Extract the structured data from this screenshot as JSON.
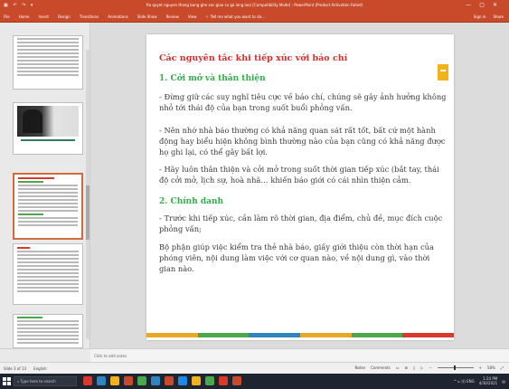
{
  "window": {
    "title": "Ra quyet nguyen thong bang ghe xac giao su ga lang lao) [Compatibility Mode] - PowerPoint (Product Activation Failed)",
    "qat_glyphs": "▣ ↶ ↷ ▾",
    "controls": [
      "—",
      "▢",
      "✕"
    ]
  },
  "menu": {
    "tabs": [
      "File",
      "Home",
      "Insert",
      "Design",
      "Transitions",
      "Animations",
      "Slide Show",
      "Review",
      "View"
    ],
    "tell_me": "Tell me what you want to do...",
    "right": [
      "Sign in",
      "Share"
    ]
  },
  "thumbnails": {
    "numbers": [
      "",
      "",
      "",
      "",
      ""
    ],
    "selected_index": 3
  },
  "slide": {
    "title": "Các nguyên tắc khi tiếp xúc với báo chí",
    "section1": "1. Cởi mở và thân thiện",
    "p1": "- Đừng giữ các suy nghĩ tiêu cực về báo chí, chúng sẽ gây ảnh hưởng không nhỏ tới thái độ của bạn trong suốt buổi phỏng vấn.",
    "p2": "- Nên nhớ nhà báo thường có khả năng quan sát rất tốt, bất cứ một hành động hay biểu hiện không bình thường nào của bạn cũng có khả năng được họ ghi lại, có thể gây bất lợi.",
    "p3": "- Hãy luôn thân thiện và cởi mở trong suốt thời gian tiếp xúc (bắt tay, thái độ cởi mở, lịch sự, hoà nhã… khiến báo giới có cái nhìn thiện cảm.",
    "section2": "2. Chính danh",
    "p4": " - Trước khi tiếp xúc, cần làm rõ thời gian, địa điểm, chủ đề, mục đích cuộc phỏng vấn;",
    "p5": " Bộ phận giúp việc kiểm tra thẻ nhà báo, giấy giới thiệu còn thời hạn của phóng viên, nội dung làm việc với cơ quan nào, về nội dung gì, vào thời gian nào.",
    "stripe_colors": [
      "#e8a824",
      "#4aa84a",
      "#2e86c1",
      "#e8a824",
      "#4aa84a",
      "#d9392b"
    ]
  },
  "notes": {
    "placeholder": "Click to add notes"
  },
  "status": {
    "slide_info": "Slide 3 of 13",
    "language": "English",
    "notes_btn": "Notes",
    "comments_btn": "Comments",
    "zoom": "58%"
  },
  "taskbar": {
    "search_placeholder": "Type here to search",
    "app_colors": [
      "#d9392b",
      "#2e86c1",
      "#f2b21b",
      "#c94a2b",
      "#4aa84a",
      "#2e86c1",
      "#c94a2b",
      "#1e88e5",
      "#f2b21b",
      "#4aa84a",
      "#d9392b",
      "#c94a2b"
    ],
    "tray": "^ ⌂ ))) ENG",
    "time": "1:24 PM",
    "date": "4/30/2021"
  },
  "colors": {
    "accent": "#c94a2b",
    "title_red": "#d42f2a",
    "heading_green": "#2fae4a"
  }
}
